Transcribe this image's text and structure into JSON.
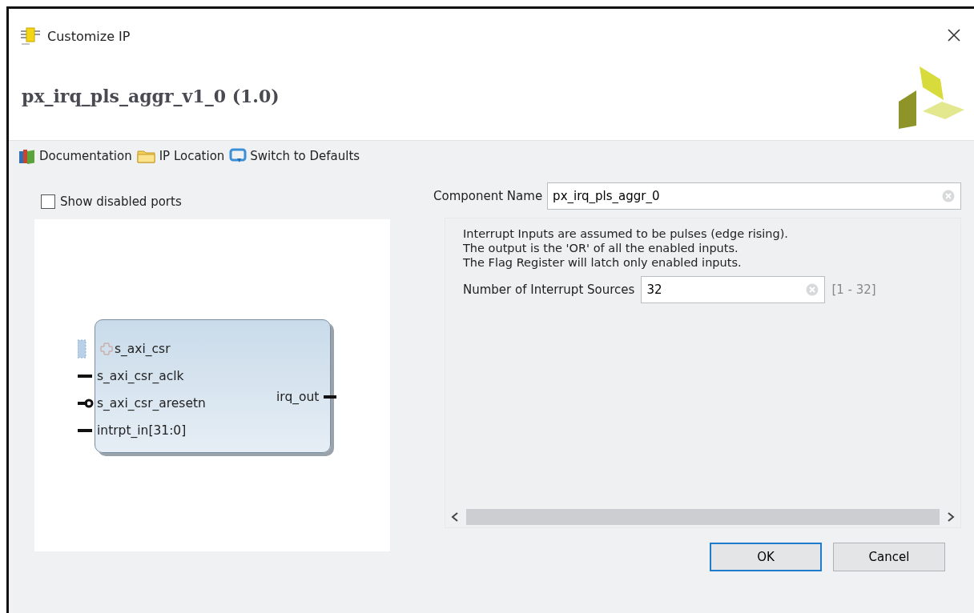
{
  "window": {
    "title": "Customize IP"
  },
  "header": {
    "title": "px_irq_pls_aggr_v1_0 (1.0)"
  },
  "toolbar": [
    {
      "kind": "docs",
      "label": "Documentation"
    },
    {
      "kind": "folder",
      "label": "IP Location"
    },
    {
      "kind": "reset",
      "label": "Switch to Defaults"
    }
  ],
  "left_panel": {
    "show_disabled_ports": {
      "label": "Show disabled ports",
      "checked": false
    },
    "symbol": {
      "inputs": [
        {
          "kind": "bus",
          "name": "s_axi_csr"
        },
        {
          "kind": "clock",
          "name": "s_axi_csr_aclk"
        },
        {
          "kind": "reset",
          "name": "s_axi_csr_aresetn"
        },
        {
          "kind": "data",
          "name": "intrpt_in[31:0]"
        }
      ],
      "outputs": [
        {
          "kind": "data",
          "name": "irq_out"
        }
      ]
    }
  },
  "component_name": {
    "label": "Component Name",
    "value": "px_irq_pls_aggr_0"
  },
  "description": [
    "Interrupt Inputs are assumed to be pulses (edge rising).",
    "The output is the 'OR' of all the enabled inputs.",
    "The Flag Register will latch only enabled inputs."
  ],
  "parameters": [
    {
      "label": "Number of Interrupt Sources",
      "value": "32",
      "range": "[1 - 32]"
    }
  ],
  "buttons": [
    {
      "label": "OK",
      "selected": true
    },
    {
      "label": "Cancel",
      "selected": false
    }
  ]
}
